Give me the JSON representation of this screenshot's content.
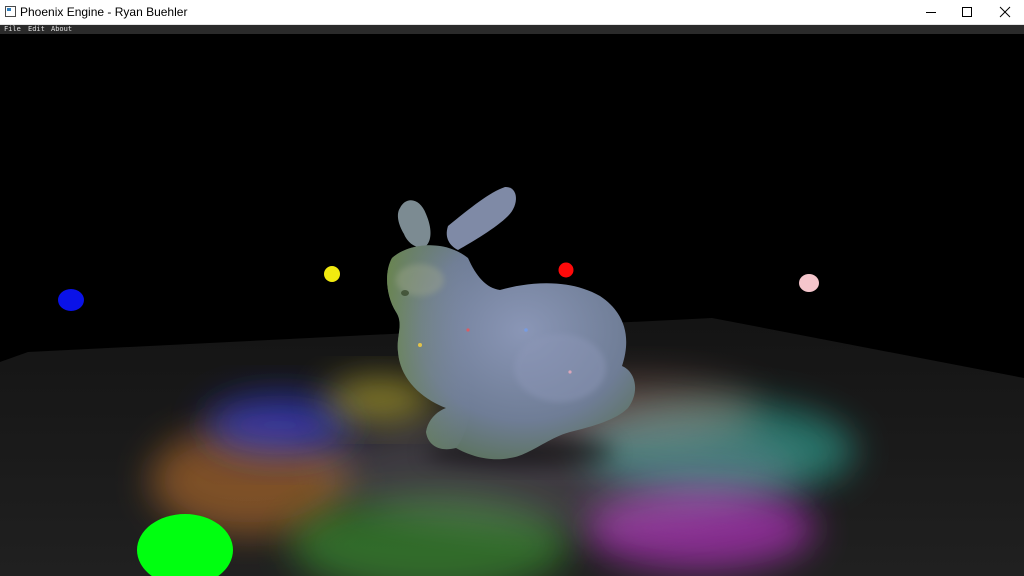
{
  "window": {
    "title": "Phoenix Engine - Ryan Buehler",
    "icon": "app-window-icon",
    "controls": [
      "minimize-icon",
      "maximize-icon",
      "close-icon"
    ]
  },
  "menubar": {
    "items": [
      {
        "label": "File"
      },
      {
        "label": "Edit"
      },
      {
        "label": "About"
      }
    ]
  },
  "scene": {
    "background": "#000000",
    "mesh": "bunny",
    "mesh_color": "#7a87a0",
    "lights": [
      {
        "name": "blue",
        "color": "#0a12e8"
      },
      {
        "name": "yellow",
        "color": "#f2ea10"
      },
      {
        "name": "red",
        "color": "#ff0a0a"
      },
      {
        "name": "pink",
        "color": "#f5c6cc"
      },
      {
        "name": "green",
        "color": "#00ff10"
      }
    ]
  }
}
